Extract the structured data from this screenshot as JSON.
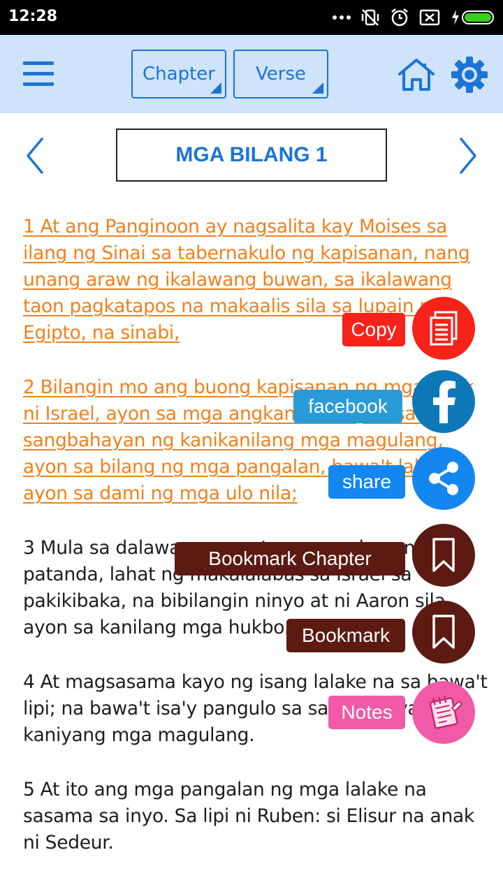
{
  "status_bar": {
    "time": "12:28"
  },
  "toolbar": {
    "chapter_label": "Chapter",
    "verse_label": "Verse"
  },
  "navigation": {
    "title": "MGA BILANG 1"
  },
  "verses": [
    {
      "text": "1 At ang Panginoon ay nagsalita kay Moises sa ilang ng Sinai sa tabernakulo ng kapisanan, nang unang araw ng ikalawang buwan, sa ikalawang taon pagkatapos na makaalis sila sa lupain ng Egipto, na sinabi,",
      "highlighted": true
    },
    {
      "text": "2 Bilangin mo ang buong kapisanan ng mga anak ni Israel, ayon sa mga angkan nila, ayon sa mga sangbahayan ng kanikanilang mga magulang, ayon sa bilang ng mga pangalan, bawa't lalake ayon sa dami ng mga ulo nila;",
      "highlighted": true
    },
    {
      "text": "3 Mula sa dalawang pung taon na gulang na patanda, lahat ng makalalabas sa Israel sa pakikibaka, na bibilangin ninyo at ni Aaron sila ayon sa kanilang mga hukbo.",
      "highlighted": false
    },
    {
      "text": "4 At magsasama kayo ng isang lalake na sa bawa't lipi; na bawa't isa'y pangulo sa sangbahayan ng kaniyang mga magulang.",
      "highlighted": false
    },
    {
      "text": "5 At ito ang mga pangalan ng mga lalake na sasama sa inyo. Sa lipi ni Ruben: si Elisur na anak ni Sedeur.",
      "highlighted": false
    }
  ],
  "fab_menu": {
    "copy_label": "Copy",
    "facebook_label": "facebook",
    "share_label": "share",
    "bookmark_chapter_label": "Bookmark Chapter",
    "bookmark_label": "Bookmark",
    "notes_label": "Notes"
  },
  "colors": {
    "accent_blue": "#1b74d6",
    "toolbar_bg": "#cfe3fb",
    "highlight_orange": "#f1801c",
    "copy_red": "#f5231a",
    "facebook_blue": "#0d78b8",
    "facebook_label_blue": "#2a9bd8",
    "share_blue": "#1386f0",
    "bookmark_brown": "#5c1a12",
    "notes_pink": "#f15aa6"
  }
}
